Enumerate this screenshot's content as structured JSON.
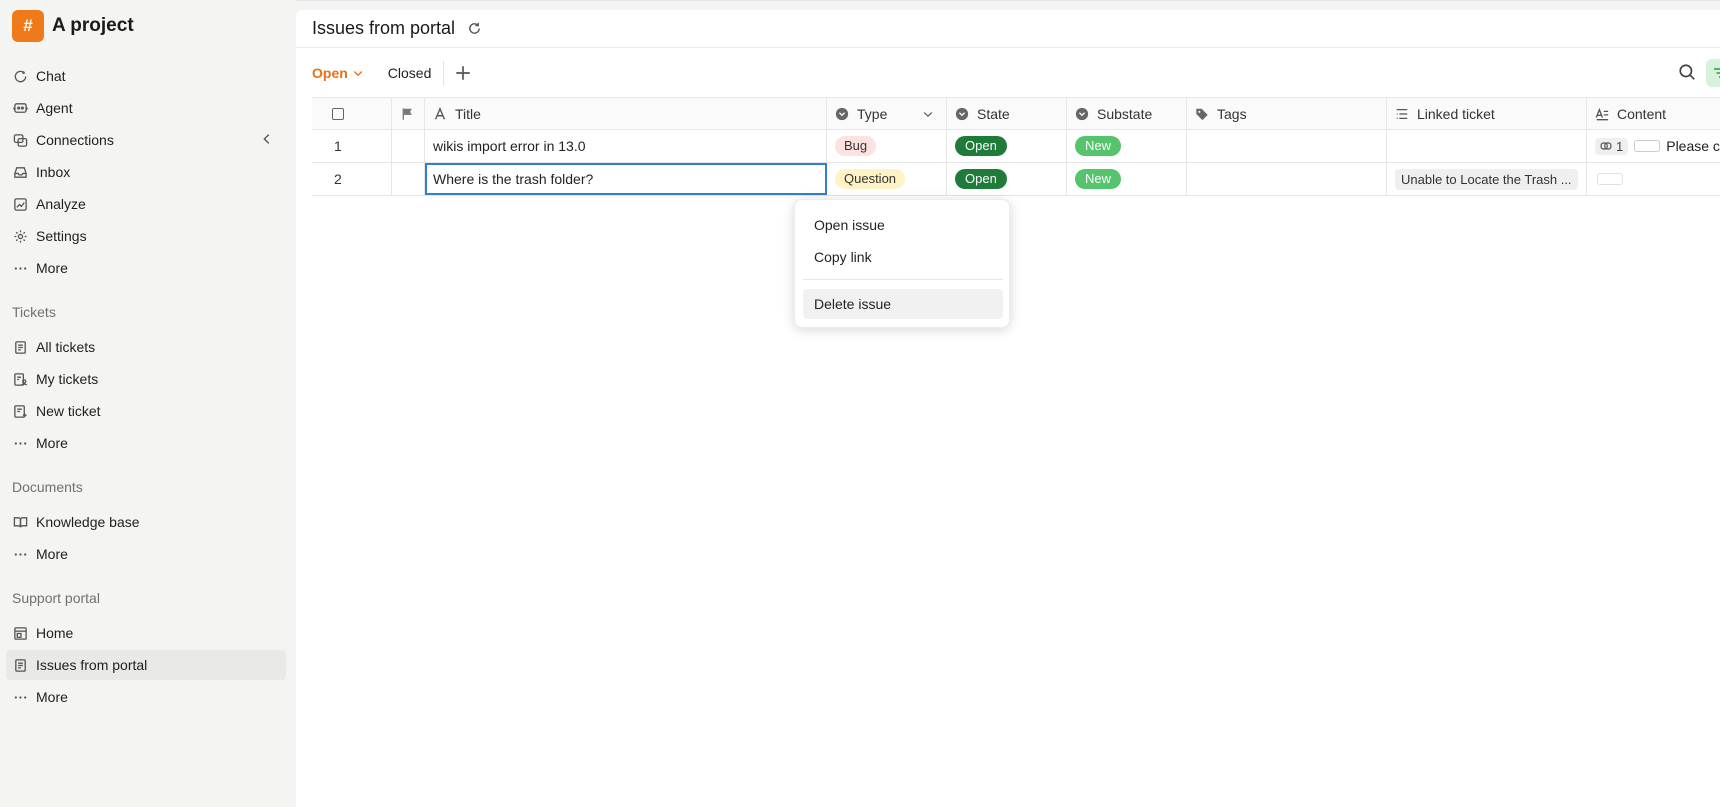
{
  "project": {
    "logo_glyph": "#",
    "name": "A project",
    "accent": "#f07a1a"
  },
  "sidebar": {
    "main_items": [
      {
        "label": "Chat",
        "icon": "chat-icon"
      },
      {
        "label": "Agent",
        "icon": "agent-icon"
      },
      {
        "label": "Connections",
        "icon": "connections-icon"
      },
      {
        "label": "Inbox",
        "icon": "inbox-icon"
      },
      {
        "label": "Analyze",
        "icon": "analyze-icon"
      },
      {
        "label": "Settings",
        "icon": "gear-icon"
      },
      {
        "label": "More",
        "icon": "more-icon"
      }
    ],
    "tickets_section": "Tickets",
    "tickets_items": [
      {
        "label": "All tickets",
        "icon": "ticket-list-icon"
      },
      {
        "label": "My tickets",
        "icon": "my-tickets-icon"
      },
      {
        "label": "New ticket",
        "icon": "new-ticket-icon"
      },
      {
        "label": "More",
        "icon": "more-icon"
      }
    ],
    "documents_section": "Documents",
    "documents_items": [
      {
        "label": "Knowledge base",
        "icon": "book-icon"
      },
      {
        "label": "More",
        "icon": "more-icon"
      }
    ],
    "portal_section": "Support portal",
    "portal_items": [
      {
        "label": "Home",
        "icon": "home-icon"
      },
      {
        "label": "Issues from portal",
        "icon": "issues-icon"
      },
      {
        "label": "More",
        "icon": "more-icon"
      }
    ]
  },
  "header": {
    "title": "Issues from portal"
  },
  "toolbar": {
    "open_label": "Open",
    "closed_label": "Closed"
  },
  "table": {
    "columns": [
      "Title",
      "Type",
      "State",
      "Substate",
      "Tags",
      "Linked ticket",
      "Content"
    ],
    "rows": [
      {
        "num": "1",
        "title": "wikis import error in 13.0",
        "type": "Bug",
        "state": "Open",
        "substate": "New",
        "tags": "",
        "linked": "",
        "content_count": "1",
        "content_text": "Please ch"
      },
      {
        "num": "2",
        "title": "Where is the trash folder?",
        "type": "Question",
        "state": "Open",
        "substate": "New",
        "tags": "",
        "linked": "Unable to Locate the Trash ...",
        "content_count": "",
        "content_text": ""
      }
    ]
  },
  "context_menu": {
    "items": [
      "Open issue",
      "Copy link",
      "Delete issue"
    ]
  }
}
